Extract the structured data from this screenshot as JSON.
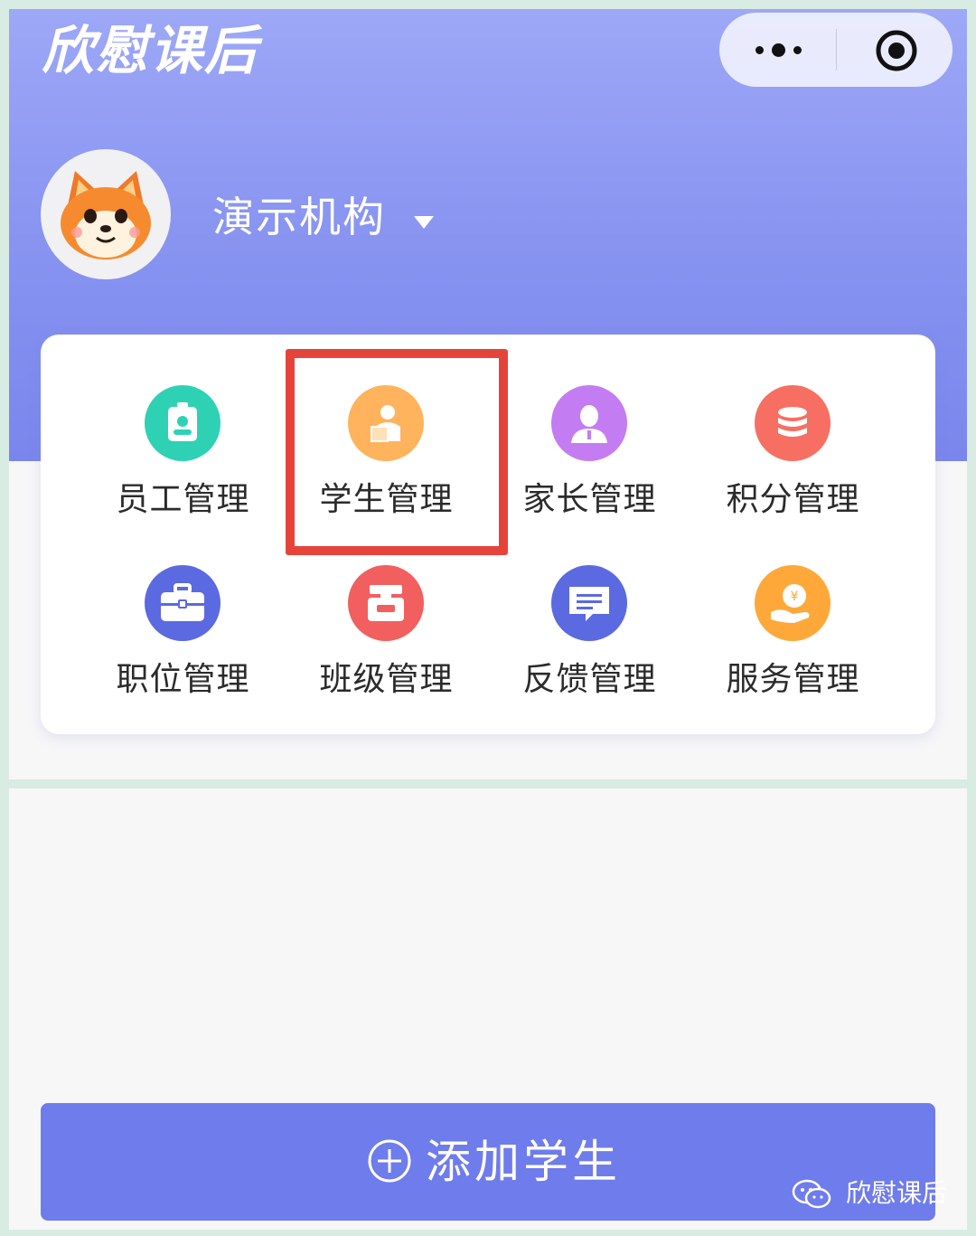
{
  "header": {
    "app_title": "欣慰课后",
    "more_icon": "more-dots-icon",
    "close_icon": "close-target-icon"
  },
  "org": {
    "name": "演示机构",
    "avatar_icon": "fox-avatar",
    "caret_icon": "caret-down-icon"
  },
  "menu": {
    "items": [
      {
        "label": "员工管理",
        "icon": "id-badge-icon",
        "color": "#2fd1b4"
      },
      {
        "label": "学生管理",
        "icon": "student-icon",
        "color": "#ffb35c"
      },
      {
        "label": "家长管理",
        "icon": "parent-icon",
        "color": "#c47cf2"
      },
      {
        "label": "积分管理",
        "icon": "coins-stack-icon",
        "color": "#f76e63"
      },
      {
        "label": "职位管理",
        "icon": "briefcase-icon",
        "color": "#5b6ae0"
      },
      {
        "label": "班级管理",
        "icon": "classroom-icon",
        "color": "#f25f5f"
      },
      {
        "label": "反馈管理",
        "icon": "chat-bubble-icon",
        "color": "#5b6ae0"
      },
      {
        "label": "服务管理",
        "icon": "service-hand-icon",
        "color": "#ffa83a"
      }
    ]
  },
  "footer": {
    "add_button_label": "添加学生",
    "add_icon": "plus-circle-icon"
  },
  "watermark": {
    "text": "欣慰课后",
    "icon": "wechat-icon"
  },
  "colors": {
    "hero_gradient_top": "#9ea8f7",
    "hero_gradient_bottom": "#7a86ec",
    "button": "#6f7ceb",
    "highlight": "#e5443a"
  }
}
